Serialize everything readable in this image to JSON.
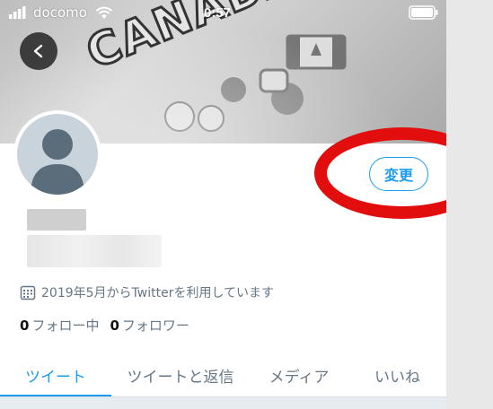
{
  "status_bar": {
    "carrier": "docomo",
    "time": "0:57"
  },
  "banner": {
    "text": "CANADA"
  },
  "profile": {
    "edit_label": "変更",
    "joined_text": "2019年5月からTwitterを利用しています",
    "following_count": "0",
    "following_label": "フォロー中",
    "followers_count": "0",
    "followers_label": "フォロワー"
  },
  "tabs": [
    {
      "label": "ツイート",
      "active": true
    },
    {
      "label": "ツイートと返信",
      "active": false
    },
    {
      "label": "メディア",
      "active": false
    },
    {
      "label": "いいね",
      "active": false
    }
  ],
  "colors": {
    "accent": "#1d9bf0",
    "highlight": "#e20e0e",
    "muted_text": "#657786"
  },
  "icons": [
    "signal-bars-icon",
    "wifi-icon",
    "battery-icon",
    "back-arrow-icon",
    "calendar-icon",
    "default-avatar-icon"
  ]
}
